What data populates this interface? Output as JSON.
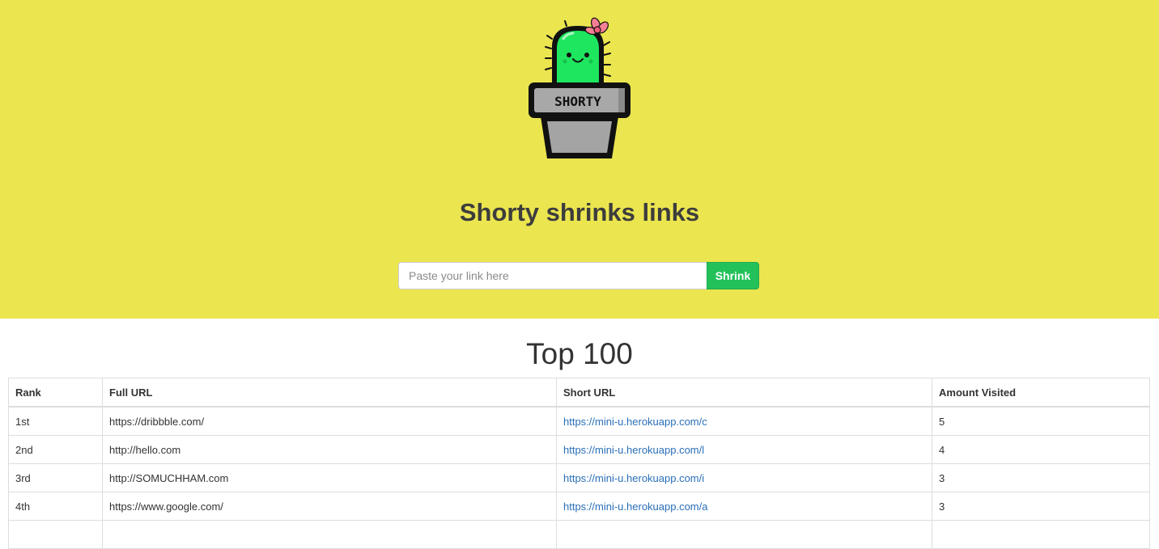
{
  "hero": {
    "logo_text": "SHORTY",
    "title": "Shorty shrinks links",
    "input_placeholder": "Paste your link here",
    "button_label": "Shrink",
    "background_color": "#ebe54f",
    "button_color": "#23c15a"
  },
  "top": {
    "title": "Top 100",
    "headers": [
      "Rank",
      "Full URL",
      "Short URL",
      "Amount Visited"
    ],
    "rows": [
      {
        "rank": "1st",
        "full_url": "https://dribbble.com/",
        "short_url": "https://mini-u.herokuapp.com/c",
        "visits": "5"
      },
      {
        "rank": "2nd",
        "full_url": "http://hello.com",
        "short_url": "https://mini-u.herokuapp.com/l",
        "visits": "4"
      },
      {
        "rank": "3rd",
        "full_url": "http://SOMUCHHAM.com",
        "short_url": "https://mini-u.herokuapp.com/i",
        "visits": "3"
      },
      {
        "rank": "4th",
        "full_url": "https://www.google.com/",
        "short_url": "https://mini-u.herokuapp.com/a",
        "visits": "3"
      },
      {
        "rank": "",
        "full_url": "",
        "short_url": "",
        "visits": ""
      }
    ]
  }
}
